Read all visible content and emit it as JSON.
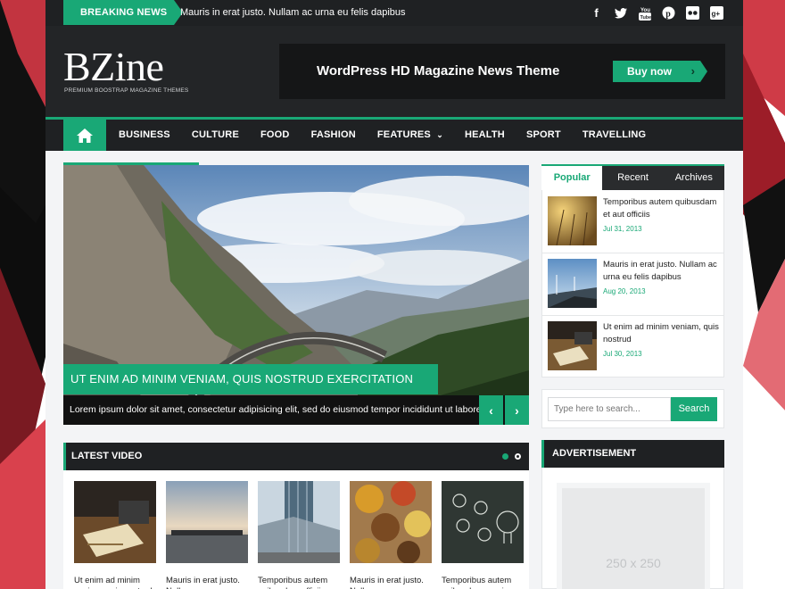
{
  "topbar": {
    "breaking_label": "BREAKING NEWS",
    "breaking_text": "Mauris in erat justo. Nullam ac urna eu felis dapibus",
    "social": [
      "facebook-icon",
      "twitter-icon",
      "youtube-icon",
      "pinterest-icon",
      "flickr-icon",
      "google-plus-icon"
    ]
  },
  "header": {
    "logo": "BZine",
    "tagline": "PREMIUM BOOSTRAP MAGAZINE THEMES",
    "banner_title": "WordPress HD Magazine News Theme",
    "banner_button": "Buy now"
  },
  "nav": {
    "home_icon": "home-icon",
    "items": [
      "BUSINESS",
      "CULTURE",
      "FOOD",
      "FASHION",
      "FEATURES",
      "HEALTH",
      "SPORT",
      "TRAVELLING"
    ]
  },
  "feature": {
    "caption": "UT ENIM AD MINIM VENIAM, QUIS NOSTRUD EXERCITATION",
    "excerpt": "Lorem ipsum dolor sit amet, consectetur adipisicing elit, sed do eiusmod tempor incididunt ut labore ..."
  },
  "latest_video": {
    "title": "LATEST VIDEO",
    "items": [
      {
        "caption": "Ut enim ad minim veniam, quis nostrud"
      },
      {
        "caption": "Mauris in erat justo. Nullam ac urna"
      },
      {
        "caption": "Temporibus autem quibusdam officiis"
      },
      {
        "caption": "Mauris in erat justo. Nullam ac urna"
      },
      {
        "caption": "Temporibus autem quibusdam omnis"
      }
    ]
  },
  "sidebar": {
    "tabs": [
      "Popular",
      "Recent",
      "Archives"
    ],
    "posts": [
      {
        "title": "Temporibus autem quibusdam et aut officiis",
        "date": "Jul 31, 2013"
      },
      {
        "title": "Mauris in erat justo. Nullam ac urna eu felis dapibus",
        "date": "Aug 20, 2013"
      },
      {
        "title": "Ut enim ad minim veniam, quis nostrud",
        "date": "Jul 30, 2013"
      }
    ],
    "search_placeholder": "Type here to search...",
    "search_button": "Search",
    "ad_title": "ADVERTISEMENT",
    "ad_size": "250 x 250"
  },
  "colors": {
    "accent": "#19a876",
    "dark": "#1f2123"
  }
}
